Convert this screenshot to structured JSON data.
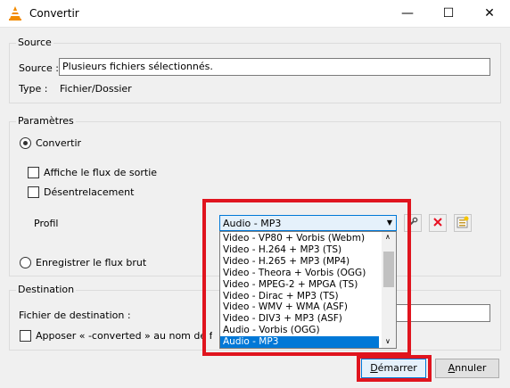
{
  "window": {
    "title": "Convertir",
    "minimize": "—",
    "maximize": "☐",
    "close": "✕"
  },
  "source": {
    "group_label": "Source",
    "source_label": "Source :",
    "source_value": "Plusieurs fichiers sélectionnés.",
    "type_label": "Type :",
    "type_value": "Fichier/Dossier"
  },
  "parameters": {
    "group_label": "Paramètres",
    "convert_label": "Convertir",
    "show_output_label": "Affiche le flux de sortie",
    "deinterlace_label": "Désentrelacement",
    "profile_label": "Profil",
    "profile_selected": "Audio - MP3",
    "profile_options": [
      "Video - VP80 + Vorbis (Webm)",
      "Video - H.264 + MP3 (TS)",
      "Video - H.265 + MP3 (MP4)",
      "Video - Theora + Vorbis (OGG)",
      "Video - MPEG-2 + MPGA (TS)",
      "Video - Dirac + MP3 (TS)",
      "Video - WMV + WMA (ASF)",
      "Video - DIV3 + MP3 (ASF)",
      "Audio - Vorbis (OGG)",
      "Audio - MP3"
    ],
    "selected_index": 9,
    "raw_dump_label": "Enregistrer le flux brut"
  },
  "destination": {
    "group_label": "Destination",
    "file_label": "Fichier de destination :",
    "file_value": "",
    "append_label": "Apposer « -converted » au nom de fichier"
  },
  "buttons": {
    "start_prefix": "",
    "start_underlined": "D",
    "start_rest": "émarrer",
    "cancel_underlined": "A",
    "cancel_rest": "nnuler"
  },
  "colors": {
    "highlight": "#e0141e",
    "accent": "#0078d7",
    "delete_red": "#e81123"
  }
}
